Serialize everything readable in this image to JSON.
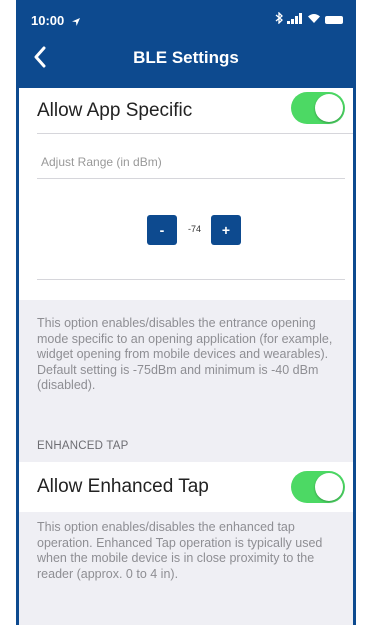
{
  "status_bar": {
    "time": "10:00",
    "indicators": "✶ .ıl ◠"
  },
  "navbar": {
    "title": "BLE Settings"
  },
  "app_specific": {
    "label": "Allow App Specific",
    "enabled": true,
    "range_label": "Adjust Range (in dBm)",
    "minus_label": "-",
    "value": "-74",
    "plus_label": "+",
    "description": "This option enables/disables the entrance opening mode specific to an opening application (for example, widget opening from mobile devices and wearables). Default setting is -75dBm and minimum is -40 dBm (disabled)."
  },
  "enhanced_tap": {
    "section_header": "ENHANCED TAP",
    "label": "Allow Enhanced Tap",
    "enabled": true,
    "description": "This option enables/disables the enhanced tap operation. Enhanced Tap operation is typically used when the mobile device is in close proximity to the reader (approx. 0 to 4 in)."
  },
  "colors": {
    "header": "#0d4a8f",
    "toggle_on": "#4cd964",
    "background": "#efeff4"
  }
}
